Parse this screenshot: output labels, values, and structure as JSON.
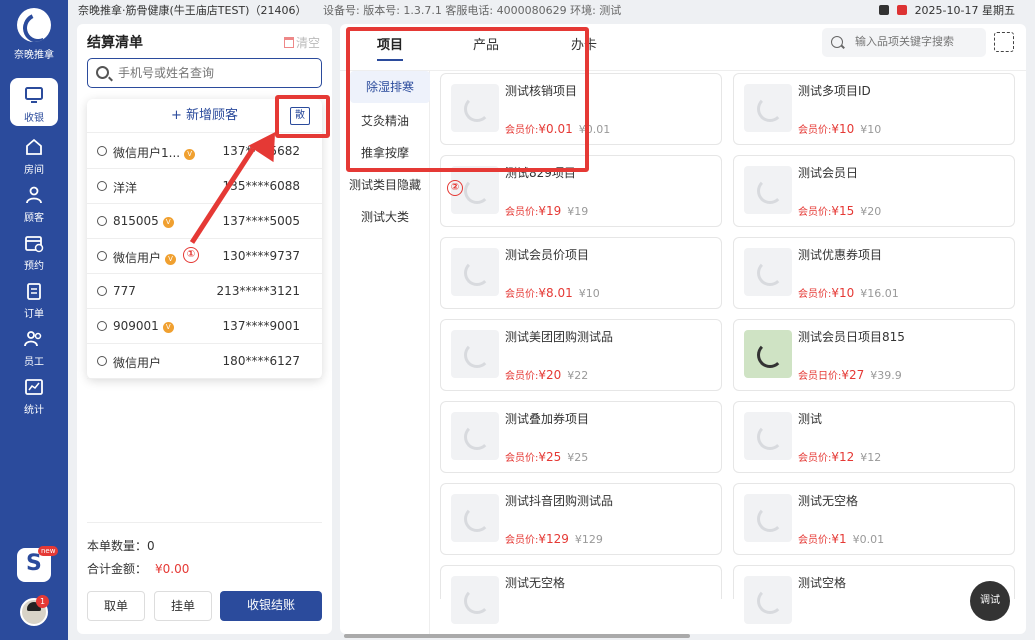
{
  "brand": {
    "name": "奈晚推拿"
  },
  "nav": [
    {
      "label": "收银",
      "icon": "monitor-icon",
      "active": true
    },
    {
      "label": "房间",
      "icon": "home-icon"
    },
    {
      "label": "顾客",
      "icon": "person-icon"
    },
    {
      "label": "预约",
      "icon": "calendar-icon"
    },
    {
      "label": "订单",
      "icon": "clipboard-icon"
    },
    {
      "label": "员工",
      "icon": "people-icon"
    },
    {
      "label": "统计",
      "icon": "chart-icon"
    }
  ],
  "app_badge": "new",
  "avatar_badge": "1",
  "topbar": {
    "store": "奈晚推拿·筋骨健康(牛王庙店TEST)（21406）",
    "meta": "设备号:  版本号:  1.3.7.1  客服电话: 4000080629  环境:  测试",
    "datetime": "2025-10-17 星期五"
  },
  "settle": {
    "title": "结算清单",
    "clear": "清空",
    "search_placeholder": "手机号或姓名查询",
    "add_customer": "+ 新增顾客",
    "walk_in": "散",
    "customers": [
      {
        "name": "微信用户1...",
        "vip": true,
        "phone": "137****5682"
      },
      {
        "name": "洋洋",
        "vip": false,
        "phone": "135****6088"
      },
      {
        "name": "815005",
        "vip": true,
        "phone": "137****5005"
      },
      {
        "name": "微信用户",
        "vip": true,
        "phone": "130****9737"
      },
      {
        "name": "777",
        "vip": false,
        "phone": "213*****3121"
      },
      {
        "name": "909001",
        "vip": true,
        "phone": "137****9001"
      },
      {
        "name": "微信用户",
        "vip": false,
        "phone": "180****6127"
      }
    ],
    "count_label": "本单数量：",
    "count_value": "0",
    "total_label": "合计金额：",
    "total_value": "¥0.00",
    "btn_cancel": "取单",
    "btn_hold": "挂单",
    "btn_checkout": "收银结账"
  },
  "tabs": [
    "项目",
    "产品",
    "办卡"
  ],
  "product_search_placeholder": "输入品项关键字搜索",
  "categories": [
    "除湿排寒",
    "艾灸精油",
    "推拿按摩",
    "测试类目隐藏",
    "测试大类"
  ],
  "products": [
    {
      "name": "测试核销项目",
      "price_label": "会员价:",
      "price": "¥0.01",
      "orig": "¥0.01"
    },
    {
      "name": "测试多项目ID",
      "price_label": "会员价:",
      "price": "¥10",
      "orig": "¥10"
    },
    {
      "name": "测试829项目",
      "price_label": "会员价:",
      "price": "¥19",
      "orig": "¥19"
    },
    {
      "name": "测试会员日",
      "price_label": "会员价:",
      "price": "¥15",
      "orig": "¥20"
    },
    {
      "name": "测试会员价项目",
      "price_label": "会员价:",
      "price": "¥8.01",
      "orig": "¥10"
    },
    {
      "name": "测试优惠券项目",
      "price_label": "会员价:",
      "price": "¥10",
      "orig": "¥16.01"
    },
    {
      "name": "测试美团团购测试品",
      "price_label": "会员价:",
      "price": "¥20",
      "orig": "¥22"
    },
    {
      "name": "测试会员日项目815",
      "price_label": "会员日价:",
      "price": "¥27",
      "orig": "¥39.9",
      "photo": true
    },
    {
      "name": "测试叠加券项目",
      "price_label": "会员价:",
      "price": "¥25",
      "orig": "¥25"
    },
    {
      "name": "测试",
      "price_label": "会员价:",
      "price": "¥12",
      "orig": "¥12"
    },
    {
      "name": "测试抖音团购测试品",
      "price_label": "会员价:",
      "price": "¥129",
      "orig": "¥129"
    },
    {
      "name": "测试无空格",
      "price_label": "会员价:",
      "price": "¥1",
      "orig": "¥0.01"
    },
    {
      "name": "测试无空格",
      "cut": true
    },
    {
      "name": "测试空格",
      "cut": true
    }
  ],
  "test_button": "调试",
  "annotations": {
    "one": "①",
    "two": "②"
  },
  "colors": {
    "brand": "#2b4b9c",
    "price": "#e53935",
    "annotation": "#e53935"
  }
}
